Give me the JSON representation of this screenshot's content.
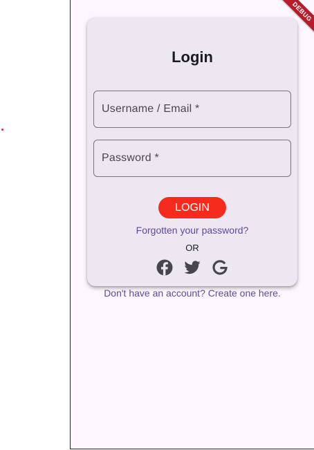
{
  "debug_banner": "DEBUG",
  "login": {
    "title": "Login",
    "username_label": "Username / Email *",
    "password_label": "Password *",
    "login_button": "LOGIN",
    "forgot_link": "Forgotten your password?",
    "or_text": "OR",
    "social_icons": [
      "facebook-icon",
      "twitter-icon",
      "google-icon"
    ],
    "signup_link": "Don't have an account? Create one here."
  },
  "colors": {
    "accent": "#f62b1d",
    "link": "#5b4b99",
    "card": "#ede7f2",
    "background": "#fdf7fd"
  }
}
